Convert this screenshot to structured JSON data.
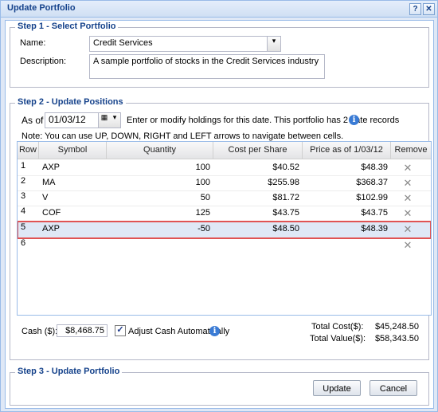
{
  "window": {
    "title": "Update Portfolio",
    "help_glyph": "?",
    "close_glyph": "✕"
  },
  "step1": {
    "legend": "Step 1 - Select Portfolio",
    "name_label": "Name:",
    "name_value": "Credit Services",
    "description_label": "Description:",
    "description_value": "A sample portfolio of stocks in the Credit Services industry"
  },
  "step2": {
    "legend": "Step 2 - Update Positions",
    "as_of_label": "As of",
    "date_value": "01/03/12",
    "info_text": "Enter or modify holdings for this date. This portfolio has 2 date records",
    "note": "Note: You can use UP, DOWN, RIGHT and LEFT arrows to navigate between cells.",
    "columns": [
      "Row",
      "Symbol",
      "Quantity",
      "Cost per Share",
      "Price as of 1/03/12",
      "Remove"
    ],
    "rows": [
      {
        "row": "1",
        "symbol": "AXP",
        "quantity": "100",
        "cost": "$40.52",
        "price": "$48.39"
      },
      {
        "row": "2",
        "symbol": "MA",
        "quantity": "100",
        "cost": "$255.98",
        "price": "$368.37"
      },
      {
        "row": "3",
        "symbol": "V",
        "quantity": "50",
        "cost": "$81.72",
        "price": "$102.99"
      },
      {
        "row": "4",
        "symbol": "COF",
        "quantity": "125",
        "cost": "$43.75",
        "price": "$43.75"
      },
      {
        "row": "5",
        "symbol": "AXP",
        "quantity": "-50",
        "cost": "$48.50",
        "price": "$48.39"
      },
      {
        "row": "6",
        "symbol": "",
        "quantity": "",
        "cost": "",
        "price": ""
      }
    ],
    "remove_glyph": "✕",
    "cash_label": "Cash ($):",
    "cash_value": "$8,468.75",
    "adjust_cash_label": "Adjust Cash Automatically",
    "adjust_cash_checked": true,
    "total_cost_label": "Total Cost($):",
    "total_cost_value": "$45,248.50",
    "total_value_label": "Total Value($):",
    "total_value_value": "$58,343.50"
  },
  "step3": {
    "legend": "Step 3 - Update Portfolio",
    "update_label": "Update",
    "cancel_label": "Cancel"
  },
  "icons": {
    "info": "i",
    "calendar": "▦",
    "dropdown": "▾",
    "check": "✓"
  },
  "colors": {
    "legend_text": "#15428b",
    "selected_row_border": "#e05353",
    "selected_row_bg": "#dfe8f6"
  }
}
